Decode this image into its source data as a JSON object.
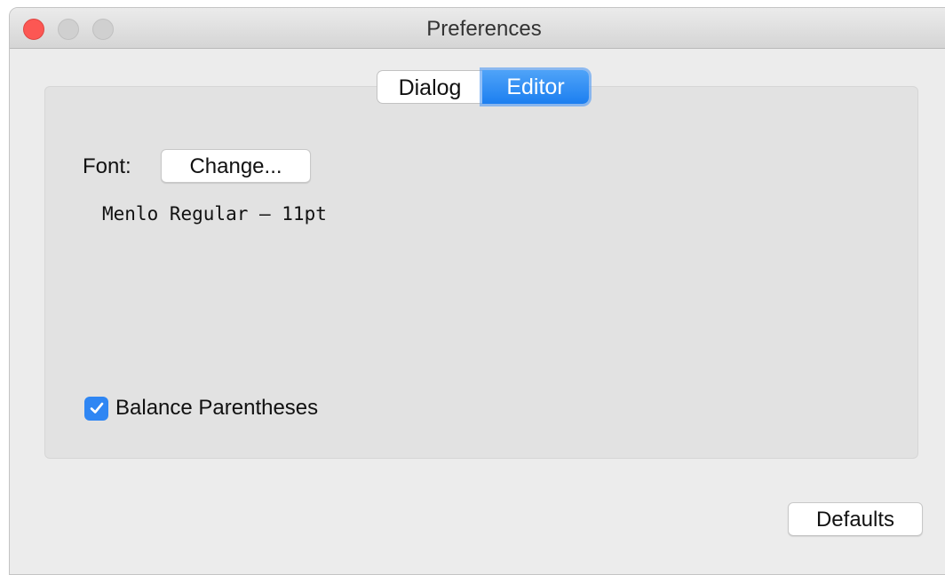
{
  "window": {
    "title": "Preferences"
  },
  "tabs": [
    {
      "label": "Dialog",
      "selected": false
    },
    {
      "label": "Editor",
      "selected": true
    }
  ],
  "editor": {
    "font_label": "Font:",
    "change_button": "Change...",
    "font_description": "Menlo Regular – 11pt",
    "balance_parentheses": {
      "label": "Balance Parentheses",
      "checked": true
    }
  },
  "footer": {
    "defaults_button": "Defaults"
  },
  "colors": {
    "accent": "#1c7ff0",
    "close": "#fc5753"
  }
}
